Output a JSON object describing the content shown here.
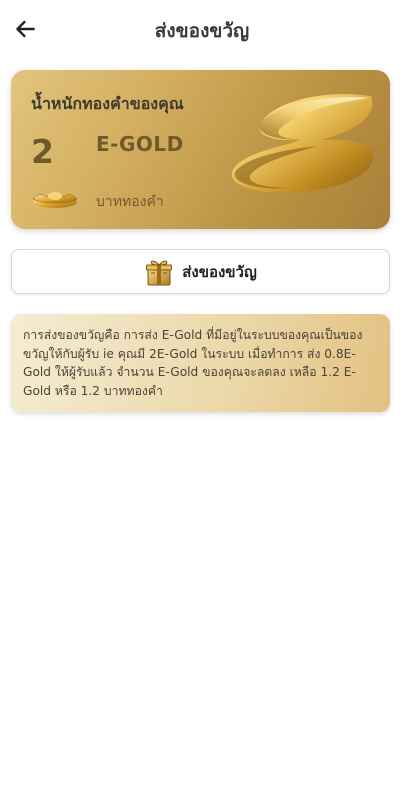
{
  "header": {
    "title": "ส่งของขวัญ",
    "back_icon": "arrow-left-icon"
  },
  "gold_card": {
    "heading": "น้ำหนักทองคำของคุณ",
    "amount": "2",
    "unit": "E-GOLD",
    "sub_label": "บาททองคำ",
    "ingot_icon": "gold-ingot-icon",
    "logo_icon": "gold-swoosh-logo"
  },
  "gift_button": {
    "label": "ส่งของขวัญ",
    "icon": "gift-box-icon"
  },
  "info": {
    "text": "การส่งของขวัญคือ การส่ง E-Gold ที่มีอยู่ในระบบของคุณเป็นของขวัญให้กับผู้รับ ie คุณมี 2E-Gold ในระบบ เมื่อทำการ ส่ง 0.8E-Gold ให้ผู้รับแล้ว จำนวน E-Gold ของคุณจะลดลง เหลือ 1.2 E-Gold หรือ 1.2 บาททองคำ"
  },
  "colors": {
    "card_gradient_start": "#e2c57c",
    "card_gradient_end": "#a8803a",
    "card_text": "#6f5a2c",
    "info_bg_start": "#f4ecd2",
    "info_bg_end": "#e3c182"
  }
}
